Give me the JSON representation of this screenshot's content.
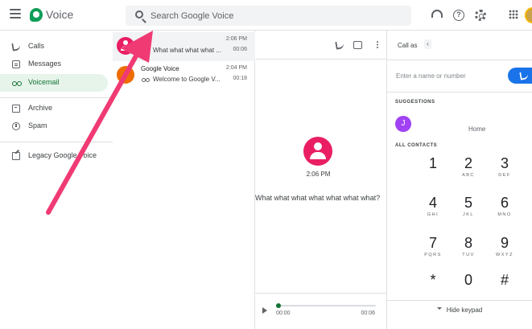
{
  "header": {
    "app_title": "Voice",
    "search_placeholder": "Search Google Voice"
  },
  "nav": {
    "items": [
      {
        "label": "Calls",
        "icon": "phone-icon"
      },
      {
        "label": "Messages",
        "icon": "message-icon"
      },
      {
        "label": "Voicemail",
        "icon": "voicemail-icon",
        "active": true
      },
      {
        "label": "Archive",
        "icon": "archive-icon"
      },
      {
        "label": "Spam",
        "icon": "spam-icon"
      },
      {
        "label": "Legacy Google Voice",
        "icon": "open-external-icon"
      }
    ]
  },
  "voicemails": [
    {
      "name": "",
      "preview": "What what what what ...",
      "time": "2:06 PM",
      "duration": "00:06",
      "blocked": true
    },
    {
      "name": "Google Voice",
      "preview": "Welcome to Google V...",
      "time": "2:04 PM",
      "duration": "00:18",
      "blocked": false
    }
  ],
  "detail": {
    "time": "2:06 PM",
    "transcript": "What what what what what what what?",
    "player": {
      "current": "00:00",
      "total": "00:06"
    }
  },
  "dialer": {
    "call_as_label": "Call as",
    "call_as_chip": "‹",
    "input_placeholder": "Enter a name or number",
    "suggestions_label": "SUGGESTIONS",
    "suggestion": {
      "initial": "J",
      "type": "Home"
    },
    "all_contacts_label": "ALL CONTACTS",
    "keys": [
      {
        "digit": "1",
        "letters": ""
      },
      {
        "digit": "2",
        "letters": "ABC"
      },
      {
        "digit": "3",
        "letters": "DEF"
      },
      {
        "digit": "4",
        "letters": "GHI"
      },
      {
        "digit": "5",
        "letters": "JKL"
      },
      {
        "digit": "6",
        "letters": "MNO"
      },
      {
        "digit": "7",
        "letters": "PQRS"
      },
      {
        "digit": "8",
        "letters": "TUV"
      },
      {
        "digit": "9",
        "letters": "WXYZ"
      },
      {
        "digit": "*",
        "letters": ""
      },
      {
        "digit": "0",
        "letters": ""
      },
      {
        "digit": "#",
        "letters": ""
      }
    ],
    "hide_keypad_label": "Hide keypad"
  },
  "colors": {
    "accent_green": "#137333",
    "active_nav_bg": "#e6f4ea",
    "avatar_pink": "#e91e63",
    "call_blue": "#1a73e8",
    "annotation_arrow": "#f03a73"
  }
}
